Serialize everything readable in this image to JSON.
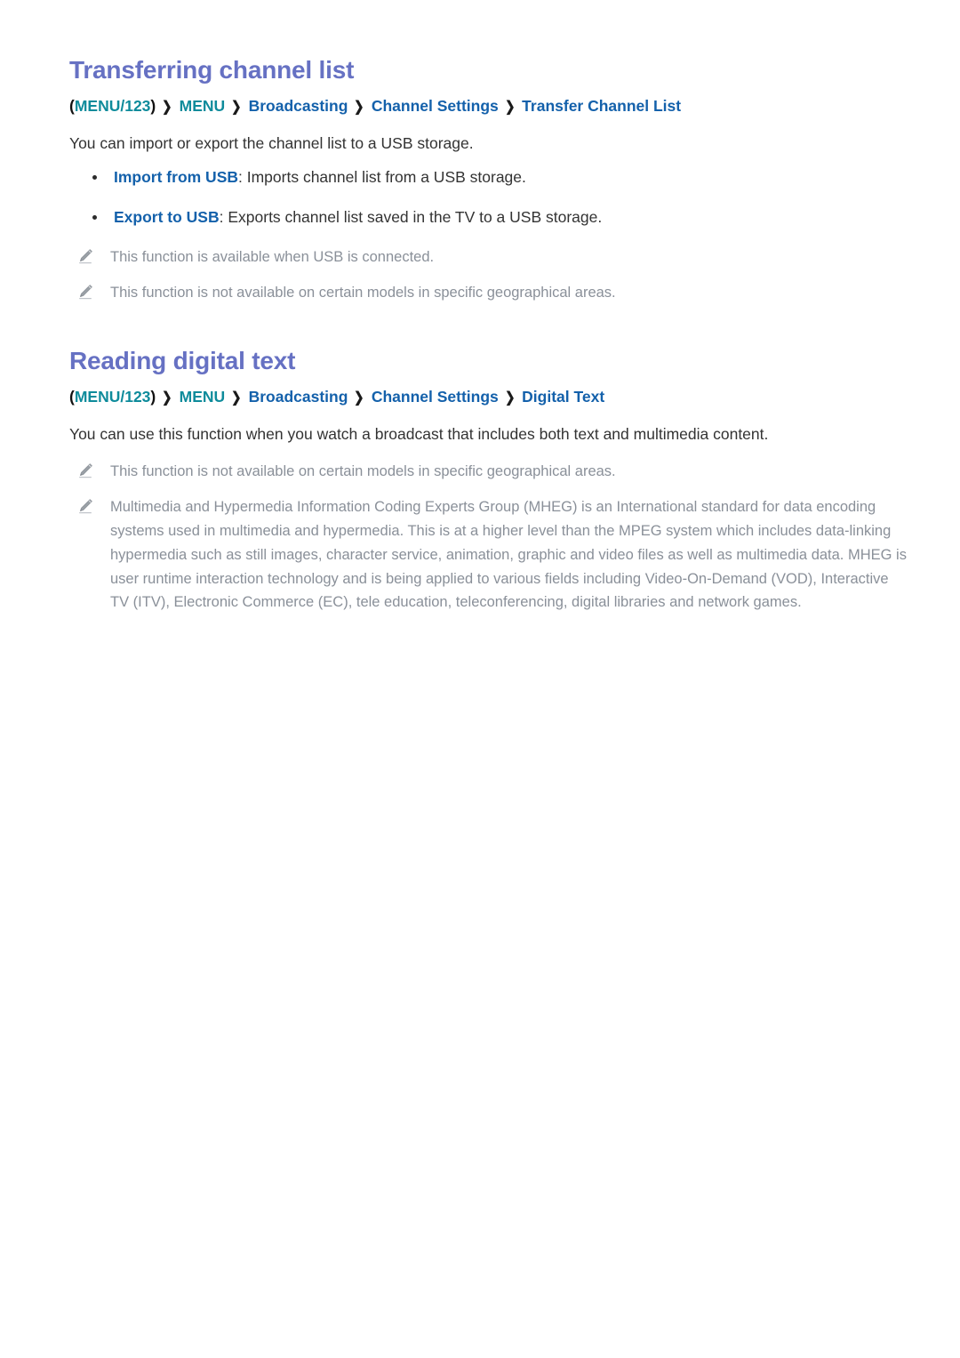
{
  "page": {
    "background": "#ffffff",
    "heading_color": "#6671c3",
    "breadcrumb_teal": "#0e8b9b",
    "breadcrumb_blue": "#1461ab",
    "body_color": "#333333",
    "note_color": "#8a9099"
  },
  "sections": [
    {
      "title": "Transferring channel list",
      "breadcrumb": {
        "open_paren": "(",
        "close_paren": ")",
        "items": [
          {
            "label": "MENU/123",
            "color": "teal",
            "paren": true
          },
          {
            "label": "MENU",
            "color": "teal"
          },
          {
            "label": "Broadcasting",
            "color": "blue"
          },
          {
            "label": "Channel Settings",
            "color": "blue"
          },
          {
            "label": "Transfer Channel List",
            "color": "blue"
          }
        ],
        "separator": "❯"
      },
      "intro": "You can import or export the channel list to a USB storage.",
      "bullets": [
        {
          "term": "Import from USB",
          "separator": ": ",
          "description": "Imports channel list from a USB storage."
        },
        {
          "term": "Export to USB",
          "separator": ": ",
          "description": "Exports channel list saved in the TV to a USB storage."
        }
      ],
      "notes": [
        {
          "icon": "pencil-icon",
          "text": "This function is available when USB is connected."
        },
        {
          "icon": "pencil-icon",
          "text": "This function is not available on certain models in specific geographical areas."
        }
      ]
    },
    {
      "title": "Reading digital text",
      "breadcrumb": {
        "open_paren": "(",
        "close_paren": ")",
        "items": [
          {
            "label": "MENU/123",
            "color": "teal",
            "paren": true
          },
          {
            "label": "MENU",
            "color": "teal"
          },
          {
            "label": "Broadcasting",
            "color": "blue"
          },
          {
            "label": "Channel Settings",
            "color": "blue"
          },
          {
            "label": "Digital Text",
            "color": "blue"
          }
        ],
        "separator": "❯"
      },
      "intro": "You can use this function when you watch a broadcast that includes both text and multimedia content.",
      "bullets": [],
      "notes": [
        {
          "icon": "pencil-icon",
          "text": "This function is not available on certain models in specific geographical areas."
        },
        {
          "icon": "pencil-icon",
          "text": "Multimedia and Hypermedia Information Coding Experts Group (MHEG) is an International standard for data encoding systems used in multimedia and hypermedia. This is at a higher level than the MPEG system which includes data-linking hypermedia such as still images, character service, animation, graphic and video files as well as multimedia data. MHEG is user runtime interaction technology and is being applied to various fields including Video-On-Demand (VOD), Interactive TV (ITV), Electronic Commerce (EC), tele education, teleconferencing, digital libraries and network games."
        }
      ]
    }
  ]
}
